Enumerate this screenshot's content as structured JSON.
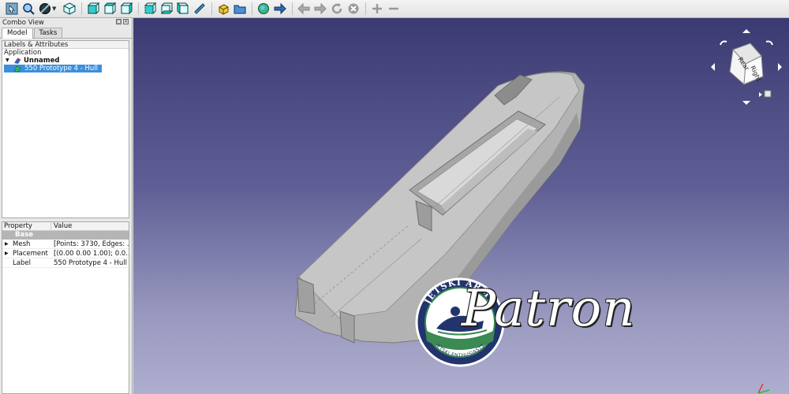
{
  "toolbar": {
    "items": [
      "select-tool-icon",
      "zoom-icon",
      "draw-style-icon",
      "view-isometric-icon",
      "view-front-icon",
      "view-top-icon",
      "view-right-icon",
      "view-rear-icon",
      "view-bottom-icon",
      "view-left-icon",
      "measure-icon",
      "part-icon",
      "group-icon",
      "web-icon",
      "forward-nav-icon",
      "back-icon",
      "next-icon",
      "refresh-icon",
      "stop-icon",
      "zoom-in-icon",
      "zoom-out-icon"
    ]
  },
  "combo_view": {
    "title": "Combo View",
    "tabs": [
      {
        "label": "Model",
        "active": true
      },
      {
        "label": "Tasks",
        "active": false
      }
    ],
    "labels_header": "Labels & Attributes",
    "application_label": "Application",
    "document_name": "Unnamed",
    "selected_object": "550 Prototype 4 - Hull"
  },
  "property_editor": {
    "col_property": "Property",
    "col_value": "Value",
    "group": "Base",
    "rows": [
      {
        "name": "Mesh",
        "value": "[Points: 3730, Edges: ...",
        "expandable": true
      },
      {
        "name": "Placement",
        "value": "[(0.00 0.00 1.00); 0.0...",
        "expandable": true
      },
      {
        "name": "Label",
        "value": "550 Prototype 4 - Hull",
        "expandable": false
      }
    ]
  },
  "nav_cube": {
    "face_top": "Rear",
    "face_right": "Right"
  },
  "logo": {
    "ring_text_top": "JETSKI ARMY",
    "ring_text_bottom": "JETSKI ENTHUSIASTS",
    "script_text": "Patron"
  },
  "colors": {
    "viewport_top": "#3b3a72",
    "viewport_bottom": "#aeaecf",
    "selection": "#3b8fdc",
    "hull": "#b0b0b0",
    "logo_navy": "#22336e",
    "logo_green": "#3a8a52"
  }
}
